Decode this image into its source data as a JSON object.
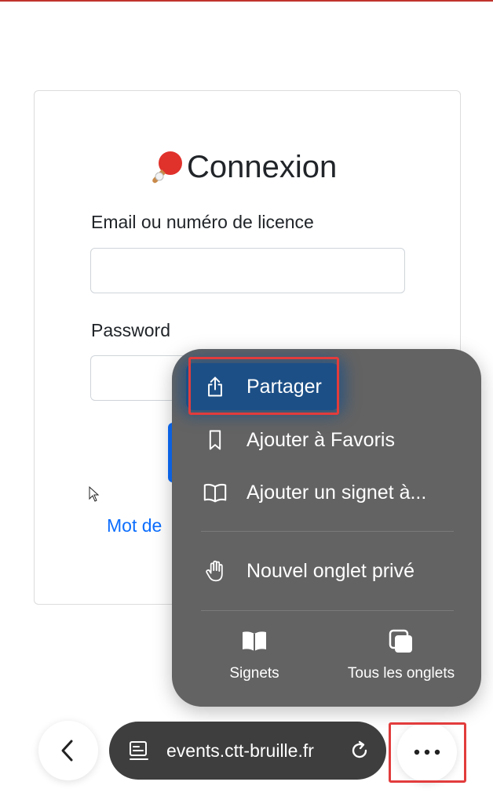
{
  "login": {
    "title": "Connexion",
    "title_icon": "ping-pong-paddle-icon",
    "email_label": "Email ou numéro de licence",
    "email_value": "",
    "password_label": "Password",
    "password_value": "",
    "forgot_link": "Mot de"
  },
  "menu": {
    "items": [
      {
        "label": "Partager",
        "icon": "share-icon"
      },
      {
        "label": "Ajouter à Favoris",
        "icon": "bookmark-icon"
      },
      {
        "label": "Ajouter un signet à...",
        "icon": "book-icon"
      },
      {
        "label": "Nouvel onglet privé",
        "icon": "hand-icon"
      }
    ],
    "bottom": [
      {
        "label": "Signets",
        "icon": "bookmarks-book-icon"
      },
      {
        "label": "Tous les onglets",
        "icon": "tabs-icon"
      }
    ]
  },
  "toolbar": {
    "url": "events.ctt-bruille.fr",
    "back_icon": "chevron-left-icon",
    "page_icon": "page-settings-icon",
    "reload_icon": "reload-icon",
    "more_icon": "more-dots-icon"
  },
  "colors": {
    "accent": "#0d6efd",
    "menu_bg": "#636363",
    "url_bar_bg": "#3e3e3e",
    "highlight": "#e23c3c"
  }
}
